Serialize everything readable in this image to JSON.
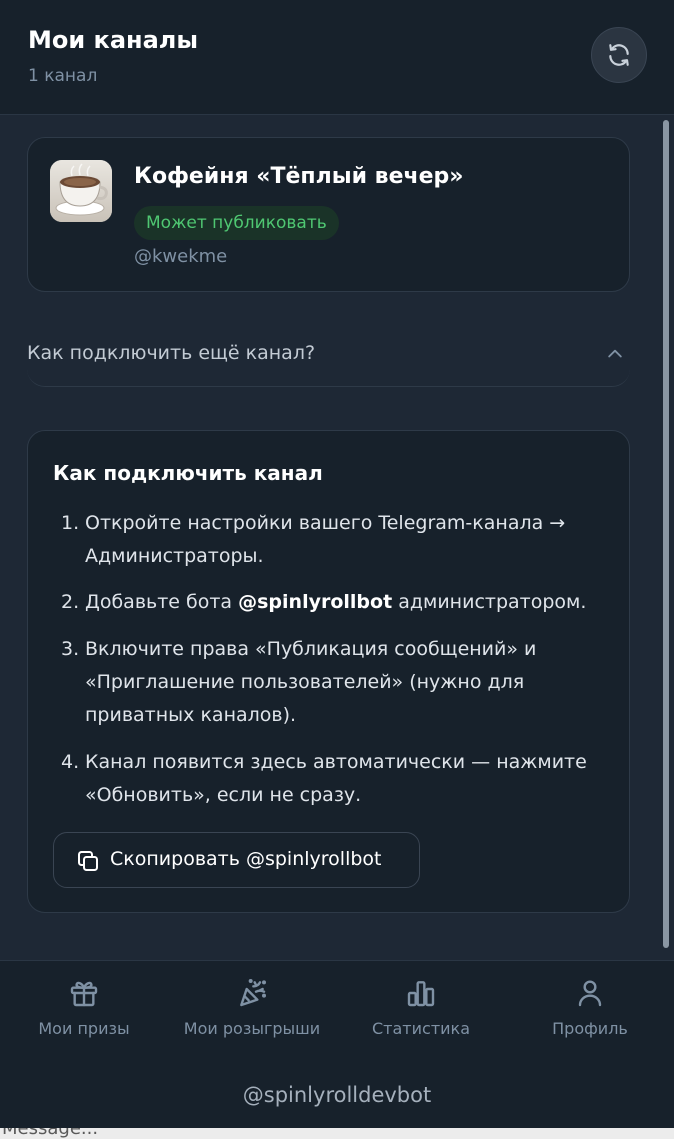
{
  "header": {
    "title": "Мои каналы",
    "subtitle": "1 канал",
    "refresh_icon": "refresh-icon"
  },
  "channel": {
    "name": "Кофейня «Тёплый вечер»",
    "status": "Может публиковать",
    "handle": "@kwekme",
    "status_color": "#4fc772"
  },
  "faq": {
    "question": "Как подключить ещё канал?",
    "chevron_icon": "chevron-up-icon"
  },
  "guide": {
    "title": "Как подключить канал",
    "steps": [
      {
        "num": "1.",
        "text": "Откройте настройки вашего Telegram-канала → Администраторы."
      },
      {
        "num": "2.",
        "prefix": "Добавьте бота ",
        "bold": "@spinlyrollbot",
        "suffix": " администратором."
      },
      {
        "num": "3.",
        "text": "Включите права «Публикация сообщений» и «Приглашение пользователей» (нужно для приватных каналов)."
      },
      {
        "num": "4.",
        "text": "Канал появится здесь автоматически — нажмите «Обновить», если не сразу."
      }
    ],
    "copy_button_label": "Скопировать @spinlyrollbot"
  },
  "nav": {
    "items": [
      {
        "label": "Мои призы",
        "icon": "gift-icon"
      },
      {
        "label": "Мои розыгрыши",
        "icon": "party-popper-icon"
      },
      {
        "label": "Статистика",
        "icon": "bar-chart-icon"
      },
      {
        "label": "Профиль",
        "icon": "user-icon"
      }
    ]
  },
  "bot_handle": "@spinlyrolldevbot",
  "message_input": {
    "placeholder": "Message..."
  }
}
